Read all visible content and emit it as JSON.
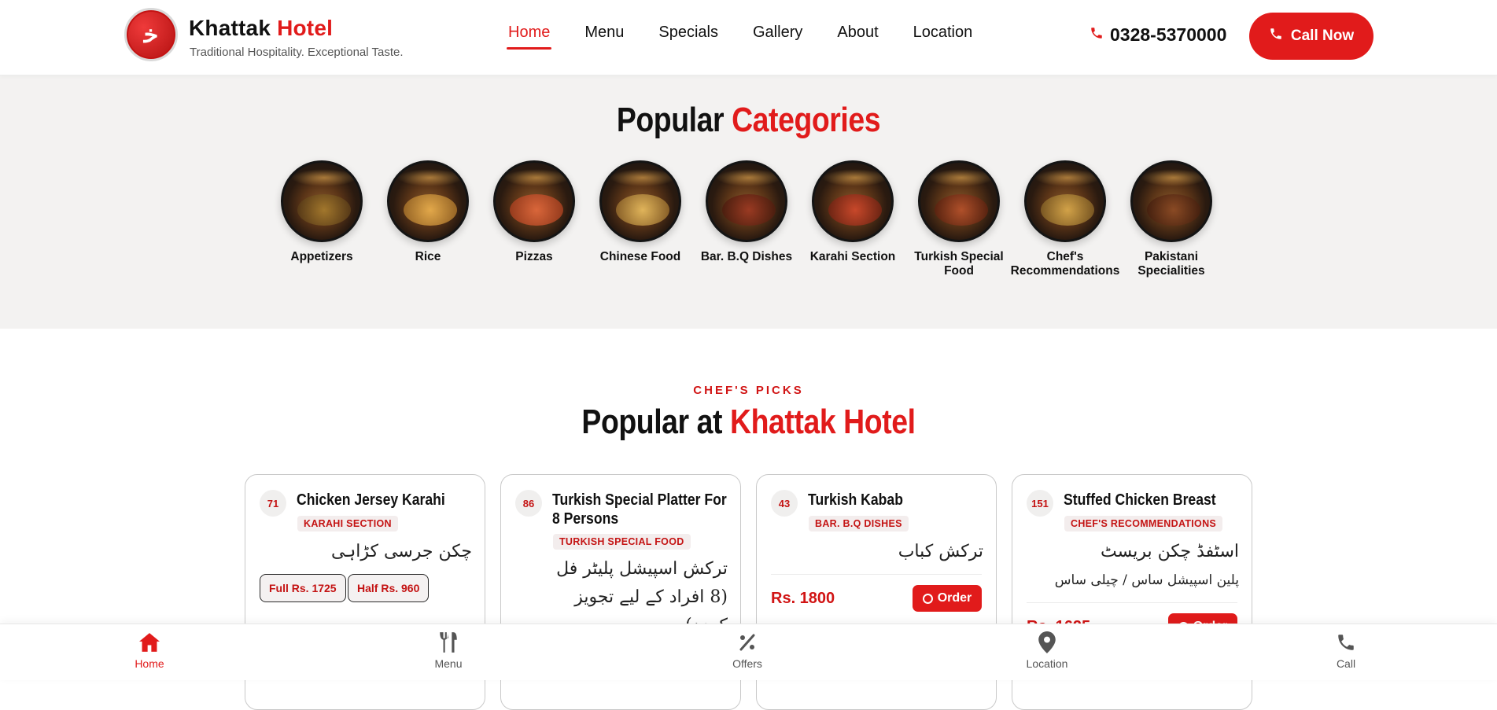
{
  "header": {
    "brand_first": "Khattak",
    "brand_second": "Hotel",
    "tagline": "Traditional Hospitality. Exceptional Taste.",
    "logo_icon": "khattak-logo",
    "nav": [
      {
        "label": "Home",
        "active": true
      },
      {
        "label": "Menu",
        "active": false
      },
      {
        "label": "Specials",
        "active": false
      },
      {
        "label": "Gallery",
        "active": false
      },
      {
        "label": "About",
        "active": false
      },
      {
        "label": "Location",
        "active": false
      }
    ],
    "phone": "0328-5370000",
    "call_label": "Call Now"
  },
  "categories": {
    "title_first": "Popular",
    "title_second": "Categories",
    "items": [
      {
        "label": "Appetizers",
        "icon": "appetizers-icon",
        "tint": "#6b4a1f"
      },
      {
        "label": "Rice",
        "icon": "rice-icon",
        "tint": "#c98a2a"
      },
      {
        "label": "Pizzas",
        "icon": "pizza-icon",
        "tint": "#b8452a"
      },
      {
        "label": "Chinese Food",
        "icon": "noodles-icon",
        "tint": "#c99a3a"
      },
      {
        "label": "Bar. B.Q Dishes",
        "icon": "bbq-icon",
        "tint": "#7a2f1a"
      },
      {
        "label": "Karahi Section",
        "icon": "karahi-icon",
        "tint": "#a8351c"
      },
      {
        "label": "Turkish Special Food",
        "icon": "kabab-icon",
        "tint": "#8e3b1d"
      },
      {
        "label": "Chef's Recommendations",
        "icon": "chef-icon",
        "tint": "#b9892f"
      },
      {
        "label": "Pakistani Specialities",
        "icon": "pakistani-icon",
        "tint": "#6a3a1c"
      }
    ]
  },
  "popular": {
    "kicker": "CHEF'S PICKS",
    "title_first": "Popular at",
    "title_second": "Khattak Hotel",
    "cards": [
      {
        "number": "71",
        "title": "Chicken Jersey Karahi",
        "badge": "KARAHI SECTION",
        "urdu": "چکن جرسی کڑاہی",
        "prices": [
          "Full Rs. 1725",
          "Half Rs. 960"
        ]
      },
      {
        "number": "86",
        "title": "Turkish Special Platter For 8 Persons",
        "badge": "TURKISH SPECIAL FOOD",
        "urdu": "ترکش اسپیشل پلیٹر فل (8 افراد کے لیے تجویز کردہ)"
      },
      {
        "number": "43",
        "title": "Turkish Kabab",
        "badge": "BAR. B.Q DISHES",
        "urdu": "ترکش کباب",
        "price": "Rs. 1800",
        "order_label": "Order"
      },
      {
        "number": "151",
        "title": "Stuffed Chicken Breast",
        "badge": "CHEF'S RECOMMENDATIONS",
        "urdu": "اسٹفڈ چکن بریسٹ",
        "urdu_sub": "پلین اسپیشل ساس / چیلی ساس",
        "price": "Rs. 1625",
        "order_label": "Order"
      }
    ]
  },
  "bottom_nav": [
    {
      "label": "Home",
      "icon": "home-icon",
      "active": true
    },
    {
      "label": "Menu",
      "icon": "utensils-icon",
      "active": false
    },
    {
      "label": "Offers",
      "icon": "percent-icon",
      "active": false
    },
    {
      "label": "Location",
      "icon": "map-pin-icon",
      "active": false
    },
    {
      "label": "Call",
      "icon": "phone-icon",
      "active": false
    }
  ],
  "colors": {
    "accent": "#e11b1b",
    "text": "#111111",
    "band": "#f3f2f1"
  }
}
